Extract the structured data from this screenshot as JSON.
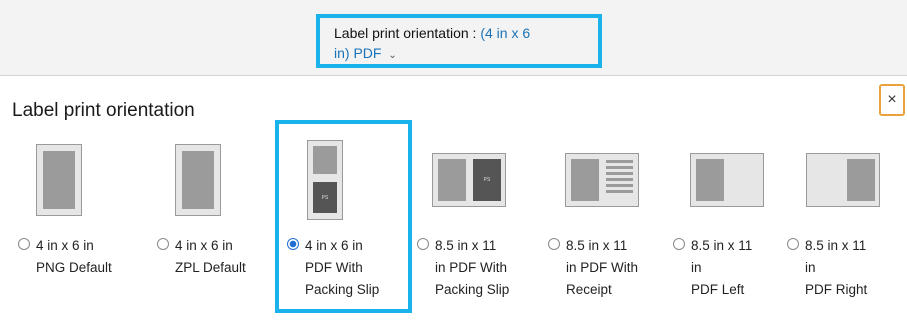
{
  "header": {
    "selector_prefix": "Label print orientation :",
    "selector_value_line1": "(4 in x 6",
    "selector_value_line2": "in) PDF",
    "chevron": "chevron-down-icon"
  },
  "dialog": {
    "title": "Label print orientation",
    "close_glyph": "×"
  },
  "options": [
    {
      "lines": [
        "4 in x 6 in",
        "PNG Default"
      ],
      "selected": false
    },
    {
      "lines": [
        "4 in x 6 in",
        "ZPL Default"
      ],
      "selected": false
    },
    {
      "lines": [
        "4 in x 6 in",
        "PDF With",
        "Packing Slip"
      ],
      "selected": true,
      "icon_text": "PS"
    },
    {
      "lines": [
        "8.5 in x 11",
        "in PDF With",
        "Packing Slip"
      ],
      "selected": false,
      "icon_text": "PS"
    },
    {
      "lines": [
        "8.5 in x 11",
        "in PDF With",
        "Receipt"
      ],
      "selected": false
    },
    {
      "lines": [
        "8.5 in x 11",
        "in",
        "PDF Left"
      ],
      "selected": false
    },
    {
      "lines": [
        "8.5 in x 11",
        "in",
        "PDF Right"
      ],
      "selected": false
    }
  ],
  "colors": {
    "highlight": "#1ab2ea",
    "link": "#1a73b8",
    "radio_selected": "#1f6fd1",
    "close_border": "#e8a33c"
  }
}
